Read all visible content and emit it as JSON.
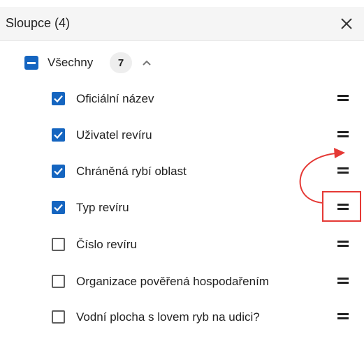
{
  "panel": {
    "title": "Sloupce (4)",
    "close_icon": "close-icon"
  },
  "all": {
    "label": "Všechny",
    "count": "7",
    "state": "indeterminate"
  },
  "columns": [
    {
      "label": "Oficiální název",
      "checked": true
    },
    {
      "label": "Uživatel revíru",
      "checked": true
    },
    {
      "label": "Chráněná rybí oblast",
      "checked": true
    },
    {
      "label": "Typ revíru",
      "checked": true
    },
    {
      "label": "Číslo revíru",
      "checked": false
    },
    {
      "label": "Organizace pověřená hospodařením",
      "checked": false
    },
    {
      "label": "Vodní plocha s lovem ryb na udici?",
      "checked": false
    }
  ],
  "colors": {
    "accent": "#1565c0",
    "annotation": "#e53935",
    "header_bg": "#f5f5f5"
  }
}
